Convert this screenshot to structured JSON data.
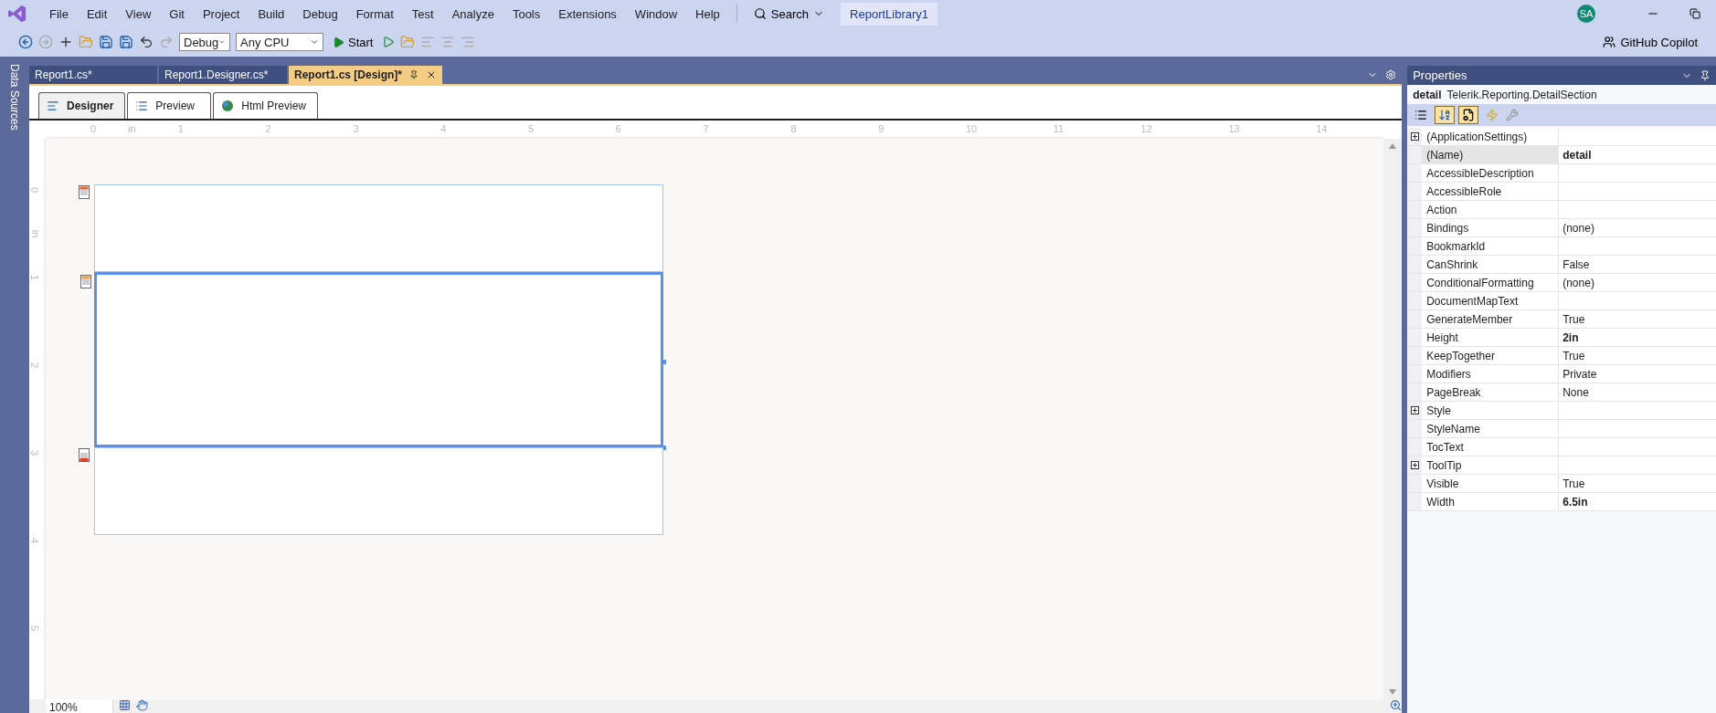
{
  "menu": [
    "File",
    "Edit",
    "View",
    "Git",
    "Project",
    "Build",
    "Debug",
    "Format",
    "Test",
    "Analyze",
    "Tools",
    "Extensions",
    "Window",
    "Help"
  ],
  "search": {
    "label": "Search"
  },
  "solution": "ReportLibrary1",
  "account": {
    "initials": "SA"
  },
  "toolbar": {
    "configuration": "Debug",
    "platform": "Any CPU",
    "start": "Start"
  },
  "copilot": "GitHub Copilot",
  "side_strip": {
    "label": "Data Sources"
  },
  "doc_tabs": [
    {
      "label": "Report1.cs*",
      "selected": false
    },
    {
      "label": "Report1.Designer.cs*",
      "selected": false
    },
    {
      "label": "Report1.cs [Design]*",
      "selected": true
    }
  ],
  "designer_tabs": [
    {
      "label": "Designer",
      "selected": true
    },
    {
      "label": "Preview",
      "selected": false
    },
    {
      "label": "Html Preview",
      "selected": false
    }
  ],
  "ruler": {
    "horizontal": [
      "0",
      "in",
      "1",
      "2",
      "3",
      "4",
      "5",
      "6",
      "7",
      "8",
      "9",
      "10",
      "11",
      "12",
      "13",
      "14"
    ],
    "vertical": [
      "0",
      "in",
      "1",
      "2",
      "3",
      "4",
      "5"
    ]
  },
  "sections": [
    {
      "kind": "page_header",
      "selected": false
    },
    {
      "kind": "detail",
      "selected": true
    },
    {
      "kind": "page_footer",
      "selected": false
    }
  ],
  "zoom": "100%",
  "properties": {
    "title": "Properties",
    "object_name": "detail",
    "object_type": "Telerik.Reporting.DetailSection",
    "view_buttons": [
      {
        "kind": "categorized",
        "selected": false
      },
      {
        "kind": "alphabetical",
        "selected": true
      },
      {
        "kind": "properties",
        "selected": true
      },
      {
        "kind": "events",
        "selected": false
      }
    ],
    "rows": [
      {
        "name": "(ApplicationSettings)",
        "value": "",
        "expandable": true,
        "selected": false
      },
      {
        "name": "(Name)",
        "value": "detail",
        "expandable": false,
        "bold": true,
        "selected": true
      },
      {
        "name": "AccessibleDescription",
        "value": "",
        "expandable": false,
        "selected": false
      },
      {
        "name": "AccessibleRole",
        "value": "",
        "expandable": false,
        "selected": false
      },
      {
        "name": "Action",
        "value": "",
        "expandable": false,
        "selected": false
      },
      {
        "name": "Bindings",
        "value": "(none)",
        "expandable": false,
        "bold": false,
        "selected": false
      },
      {
        "name": "BookmarkId",
        "value": "",
        "expandable": false,
        "selected": false
      },
      {
        "name": "CanShrink",
        "value": "False",
        "expandable": false,
        "bold": false,
        "selected": false
      },
      {
        "name": "ConditionalFormatting",
        "value": "(none)",
        "expandable": false,
        "bold": false,
        "selected": false
      },
      {
        "name": "DocumentMapText",
        "value": "",
        "expandable": false,
        "selected": false
      },
      {
        "name": "GenerateMember",
        "value": "True",
        "expandable": false,
        "bold": false,
        "selected": false
      },
      {
        "name": "Height",
        "value": "2in",
        "expandable": false,
        "bold": true,
        "selected": false
      },
      {
        "name": "KeepTogether",
        "value": "True",
        "expandable": false,
        "bold": false,
        "selected": false
      },
      {
        "name": "Modifiers",
        "value": "Private",
        "expandable": false,
        "bold": false,
        "selected": false
      },
      {
        "name": "PageBreak",
        "value": "None",
        "expandable": false,
        "bold": false,
        "selected": false
      },
      {
        "name": "Style",
        "value": "",
        "expandable": true,
        "selected": false
      },
      {
        "name": "StyleName",
        "value": "",
        "expandable": false,
        "selected": false
      },
      {
        "name": "TocText",
        "value": "",
        "expandable": false,
        "selected": false
      },
      {
        "name": "ToolTip",
        "value": "",
        "expandable": true,
        "selected": false
      },
      {
        "name": "Visible",
        "value": "True",
        "expandable": false,
        "bold": false,
        "selected": false
      },
      {
        "name": "Width",
        "value": "6.5in",
        "expandable": false,
        "bold": true,
        "selected": false
      }
    ]
  }
}
